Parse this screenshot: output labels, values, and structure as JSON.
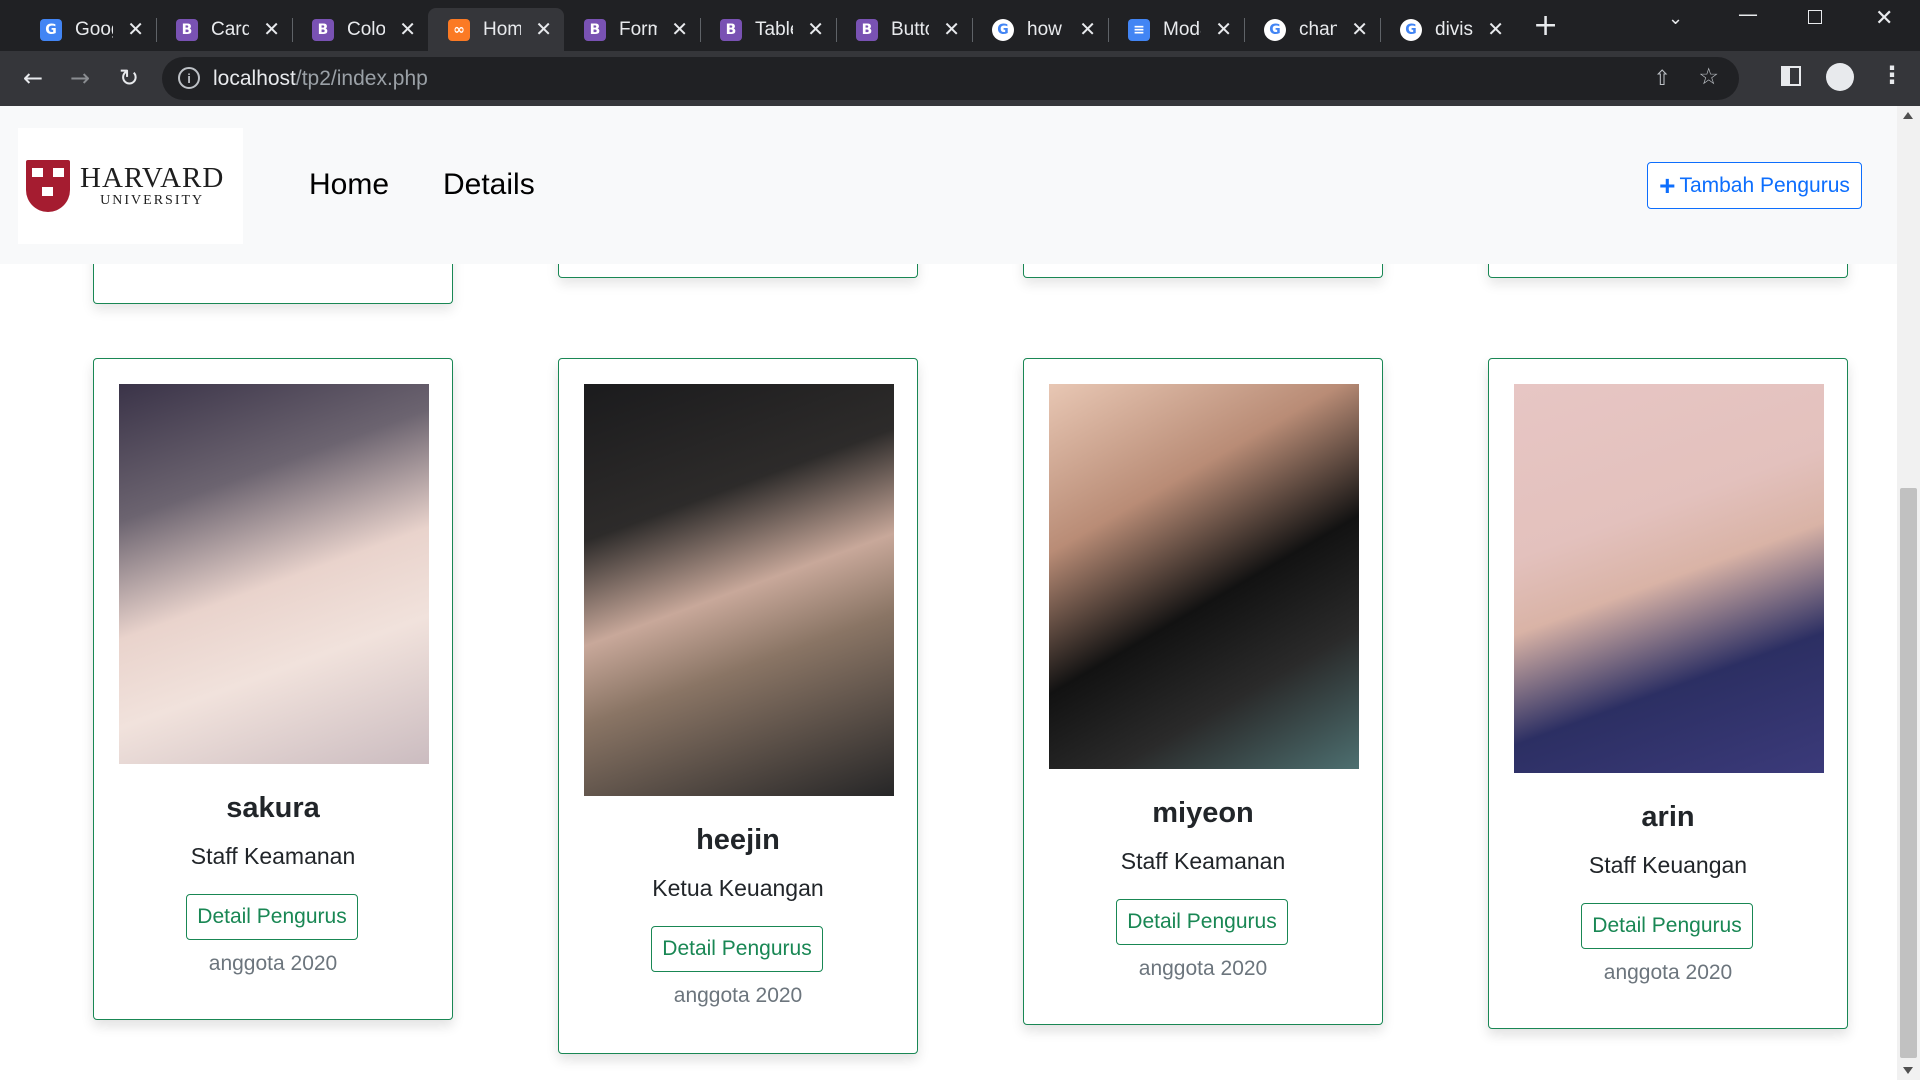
{
  "browser": {
    "tabs": [
      {
        "title": "Google Translate",
        "icon": "google-translate-icon",
        "color": "#4285f4",
        "glyph": "G"
      },
      {
        "title": "Cards",
        "icon": "bootstrap-icon",
        "color": "#7952b3",
        "glyph": "B"
      },
      {
        "title": "Colors",
        "icon": "bootstrap-icon",
        "color": "#7952b3",
        "glyph": "B"
      },
      {
        "title": "Home",
        "icon": "xampp-icon",
        "color": "#fb7a24",
        "glyph": "∞"
      },
      {
        "title": "Forms",
        "icon": "bootstrap-icon",
        "color": "#7952b3",
        "glyph": "B"
      },
      {
        "title": "Tables",
        "icon": "bootstrap-icon",
        "color": "#7952b3",
        "glyph": "B"
      },
      {
        "title": "Buttons",
        "icon": "bootstrap-icon",
        "color": "#7952b3",
        "glyph": "B"
      },
      {
        "title": "how",
        "icon": "google-icon",
        "color": "#ffffff",
        "glyph": "G"
      },
      {
        "title": "Modal",
        "icon": "google-docs-icon",
        "color": "#4285f4",
        "glyph": "≡"
      },
      {
        "title": "change",
        "icon": "google-icon",
        "color": "#ffffff",
        "glyph": "G"
      },
      {
        "title": "divisi",
        "icon": "google-icon",
        "color": "#ffffff",
        "glyph": "G"
      }
    ],
    "active_tab": 3,
    "url_host": "localhost",
    "url_path": "/tp2/index.php"
  },
  "navbar": {
    "logo_text": "HARVARD",
    "logo_subtext": "UNIVERSITY",
    "links": [
      "Home",
      "Details"
    ],
    "add_button": "Tambah Pengurus"
  },
  "colors": {
    "primary": "#0d6efd",
    "success": "#198754"
  },
  "cards": [
    {
      "name": "sakura",
      "role": "Staff Keamanan",
      "button": "Detail Pengurus",
      "footer": "anggota 2020"
    },
    {
      "name": "heejin",
      "role": "Ketua Keuangan",
      "button": "Detail Pengurus",
      "footer": "anggota 2020"
    },
    {
      "name": "miyeon",
      "role": "Staff Keamanan",
      "button": "Detail Pengurus",
      "footer": "anggota 2020"
    },
    {
      "name": "arin",
      "role": "Staff Keuangan",
      "button": "Detail Pengurus",
      "footer": "anggota 2020"
    }
  ]
}
